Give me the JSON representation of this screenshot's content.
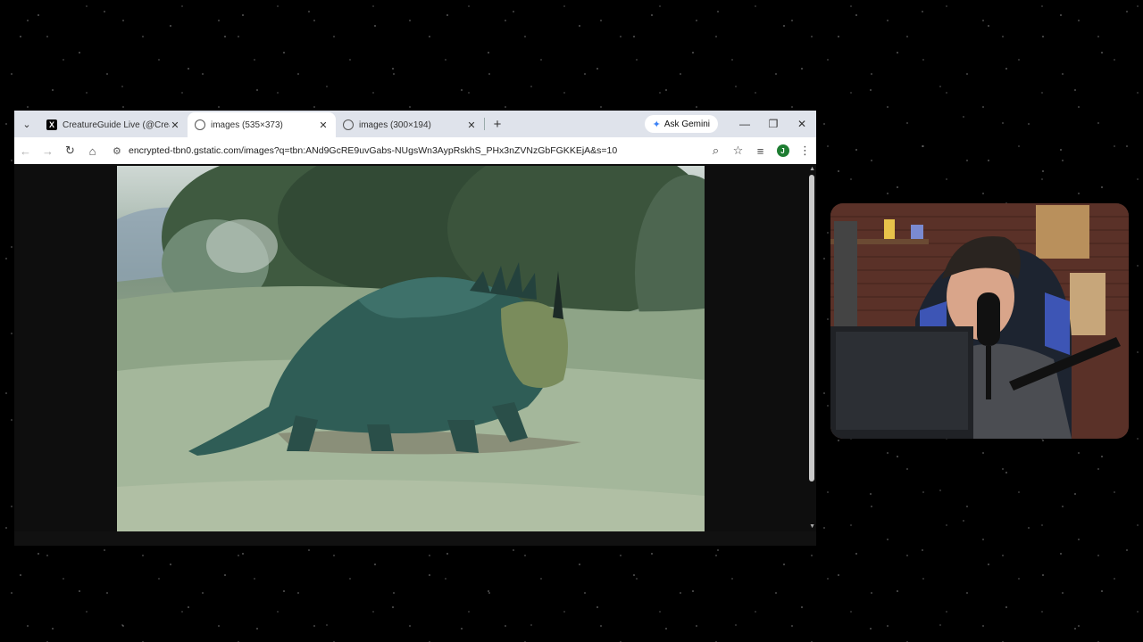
{
  "browser": {
    "tabs": [
      {
        "label": "CreatureGuide Live (@Creature",
        "favicon": "x-logo-icon",
        "active": false
      },
      {
        "label": "images (535×373)",
        "favicon": "globe-icon",
        "active": true
      },
      {
        "label": "images (300×194)",
        "favicon": "globe-icon",
        "active": false
      }
    ],
    "gemini_label": "Ask Gemini",
    "url": "encrypted-tbn0.gstatic.com/images?q=tbn:ANd9GcRE9uvGabs-NUgsWn3AypRskhS_PHx3nZVNzGbFGKKEjA&s=10",
    "profile_initial": "J"
  },
  "colors": {
    "tabbar": "#dfe3eb",
    "profile": "#1e7d32",
    "gemini_spark": "#3b82f6"
  }
}
